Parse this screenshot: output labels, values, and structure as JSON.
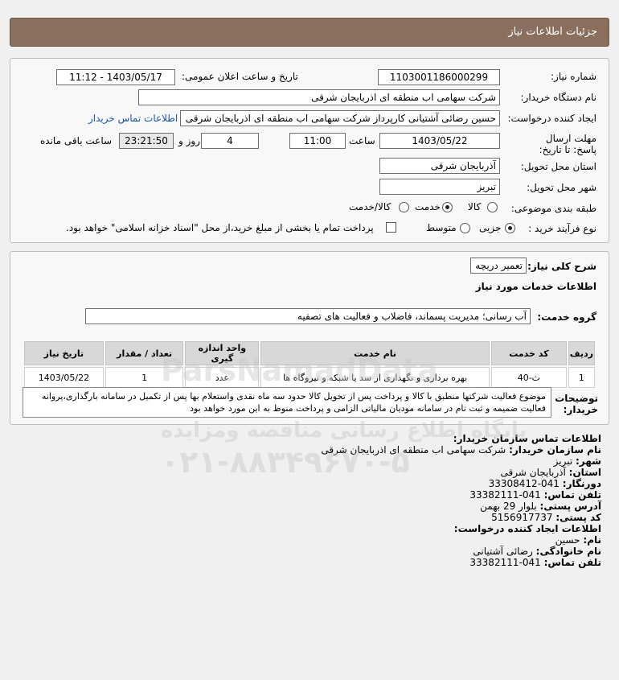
{
  "header": {
    "title": "جزئیات اطلاعات نیاز"
  },
  "form": {
    "need_number_label": "شماره نیاز:",
    "need_number": "1103001186000299",
    "announce_label": "تاریخ و ساعت اعلان عمومی:",
    "announce_value": "1403/05/17 - 11:12",
    "buyer_label": "نام دستگاه خریدار:",
    "buyer_value": "شرکت سهامی اب منطقه ای اذربایجان شرقی",
    "creator_label": "ایجاد کننده درخواست:",
    "creator_value": "حسین رضائی آشتیانی کارپرداز شرکت سهامی اب منطقه ای اذربایجان شرقی",
    "contact_link": "اطلاعات تماس خریدار",
    "deadline_label": "مهلت ارسال پاسخ: تا تاریخ:",
    "deadline_date": "1403/05/22",
    "time_label": "ساعت",
    "deadline_time": "11:00",
    "days_value": "4",
    "days_label": "روز و",
    "remaining_time": "23:21:50",
    "remaining_label": "ساعت باقی مانده",
    "province_label": "استان محل تحویل:",
    "province_value": "آذربایجان شرقی",
    "city_label": "شهر محل تحویل:",
    "city_value": "تبریز",
    "category_label": "طبقه بندی موضوعی:",
    "category_options": [
      "کالا",
      "خدمت",
      "کالا/خدمت"
    ],
    "category_selected": 1,
    "process_label": "نوع فرآیند خرید :",
    "process_options": [
      "جزیی",
      "متوسط"
    ],
    "process_selected": 0,
    "treasury_text": "پرداخت تمام یا بخشی از مبلغ خرید،از محل \"اسناد خزانه اسلامی\" خواهد بود."
  },
  "summary": {
    "label": "شرح کلی نیاز:",
    "value": "تعمیر دریچه",
    "services_title": "اطلاعات خدمات مورد نیاز",
    "group_label": "گروه خدمت:",
    "group_value": "آب رسانی؛ مدیریت پسماند، فاضلاب و فعالیت های تصفیه"
  },
  "table": {
    "headers": [
      "ردیف",
      "کد خدمت",
      "نام خدمت",
      "واحد اندازه گیری",
      "تعداد / مقدار",
      "تاریخ نیاز"
    ],
    "rows": [
      [
        "1",
        "ث-40",
        "بهره برداری و نگهداری از سد یا شبکه و نیروگاه ها",
        "عدد",
        "1",
        "1403/05/22"
      ]
    ]
  },
  "notes": {
    "label": "توضیحات خریدار:",
    "text": "موضوع فعالیت شرکتها منطبق با کالا و پرداخت پس از تحویل کالا حدود سه ماه نقدی واستعلام بها پس از تکمیل در سامانه بارگذاری،پروانه فعالیت ضمیمه و ثبت نام در سامانه مودیان مالیاتی الزامی و پرداخت منوط به این مورد خواهد بود"
  },
  "buyer_contact": {
    "title": "اطلاعات تماس سازمان خریدار:",
    "org_label": "نام سازمان خریدار:",
    "org_value": "شرکت سهامی اب منطقه ای اذربایجان شرقی",
    "city_label": "شهر:",
    "city_value": "تبریز",
    "province_label": "استان:",
    "province_value": "آذربایجان شرقی",
    "fax_label": "دورنگار:",
    "fax_value": "041-33308412",
    "phone_label": "تلفن تماس:",
    "phone_value": "041-33382111",
    "address_label": "آدرس پستی:",
    "address_value": "بلوار 29 بهمن",
    "postal_label": "کد پستی:",
    "postal_value": "5156917737"
  },
  "creator_contact": {
    "title": "اطلاعات ایجاد کننده درخواست:",
    "name_label": "نام:",
    "name_value": "حسین",
    "family_label": "نام خانوادگی:",
    "family_value": "رضائی آشتیانی",
    "phone_label": "تلفن تماس:",
    "phone_value": "041-33382111"
  },
  "watermark": {
    "brand": "ParsNamadData",
    "line1": "پایگاه اطلاع رسانی مناقصه ومزایده",
    "line2": "۰۲۱-۸۸۳۴۹۶۷۰-۵"
  },
  "colors": {
    "titlebar": "#8a6f5e",
    "link": "#1a55b4"
  }
}
